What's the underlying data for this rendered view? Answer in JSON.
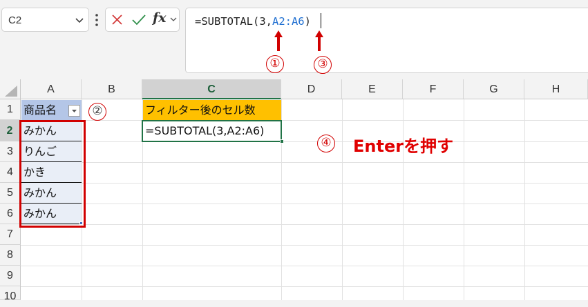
{
  "name_box": {
    "value": "C2"
  },
  "formula_bar": {
    "cancel_icon": "x-icon",
    "enter_icon": "check-icon",
    "insert_function_label": "fx",
    "formula_prefix": "=SUBTOTAL(3,",
    "formula_ref": "A2:A6",
    "formula_suffix": ")"
  },
  "columns": [
    "A",
    "B",
    "C",
    "D",
    "E",
    "F",
    "G",
    "H"
  ],
  "rows": [
    "1",
    "2",
    "3",
    "4",
    "5",
    "6",
    "7",
    "8",
    "9",
    "10"
  ],
  "cells": {
    "A1": "商品名",
    "A2": "みかん",
    "A3": "りんご",
    "A4": "かき",
    "A5": "みかん",
    "A6": "みかん",
    "C1": "フィルター後のセル数",
    "C2": "=SUBTOTAL(3,A2:A6)"
  },
  "annotations": {
    "step1": "①",
    "step2": "②",
    "step3": "③",
    "step4": "④",
    "step4_text": "Enterを押す"
  },
  "colors": {
    "header_fill_a1": "#b4c6e7",
    "header_fill_c1": "#ffc000",
    "annotation_red": "#d10000",
    "accent_green": "#217346",
    "range_ref_blue": "#1f6fd1"
  }
}
